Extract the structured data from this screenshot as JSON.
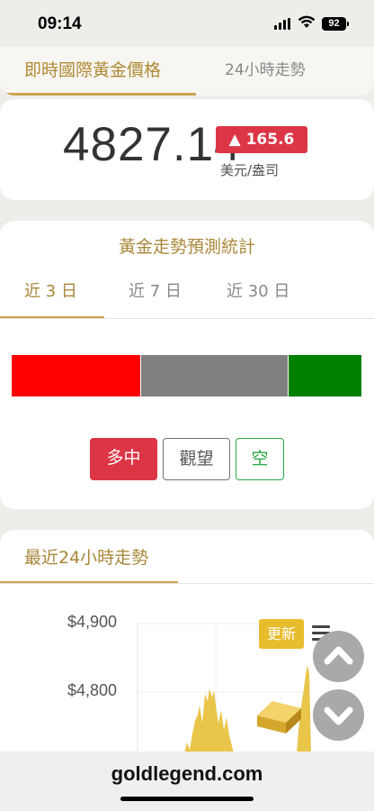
{
  "status": {
    "time": "09:14",
    "battery": "92"
  },
  "tabs": {
    "active": "即時國際黃金價格",
    "inactive": "24小時走勢"
  },
  "price": {
    "value": "4827.14",
    "change": "▲ 165.6",
    "unit": "美元/盎司"
  },
  "forecast": {
    "title": "黃金走勢預測統計",
    "tabs": [
      "近 3 日",
      "近 7 日",
      "近 30 日"
    ],
    "bars": [
      {
        "color": "#ff0000",
        "share": 0.37
      },
      {
        "color": "#808080",
        "share": 0.42
      },
      {
        "color": "#008000",
        "share": 0.21
      }
    ],
    "buttons": {
      "bull": "多中",
      "watch": "觀望",
      "bear": "空"
    }
  },
  "trend": {
    "title": "最近24小時走勢",
    "yticks": [
      "$4,900",
      "$4,800"
    ],
    "update_label": "更新"
  },
  "footer": {
    "domain": "goldlegend.com"
  },
  "colors": {
    "accent_gold": "#c9a550",
    "up_red": "#dc3545",
    "bear_green": "#28a745",
    "update_yellow": "#e7bd2e"
  }
}
